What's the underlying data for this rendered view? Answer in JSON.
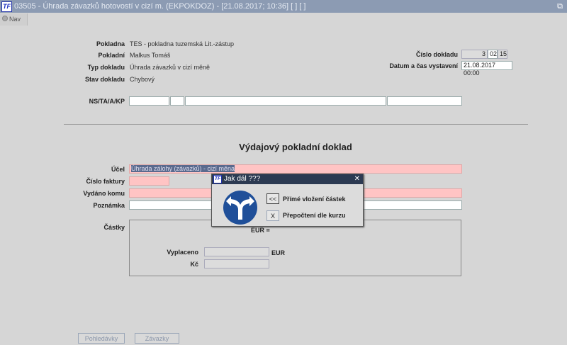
{
  "window": {
    "title": "03505 - Úhrada závazků hotovostí v cizí m. (EKPOKDOZ) - [21.08.2017; 10:36]  [ ]  [ ]",
    "logo": "TF"
  },
  "nav": {
    "label": "Nav"
  },
  "header": {
    "pokladna": {
      "label": "Pokladna",
      "value": "TES - pokladna tuzemská Lit.-zástup"
    },
    "pokladni": {
      "label": "Pokladní",
      "value": "Malkus Tomáš"
    },
    "typ": {
      "label": "Typ dokladu",
      "value": "Úhrada závazků v cizí měně"
    },
    "stav": {
      "label": "Stav dokladu",
      "value": "Chybový"
    },
    "ns": {
      "label": "NS/TA/A/KP"
    },
    "cislo": {
      "label": "Číslo dokladu",
      "parts": [
        "3",
        "02",
        "15"
      ]
    },
    "datum": {
      "label": "Datum a čas vystavení",
      "value": "21.08.2017 00:00"
    }
  },
  "form": {
    "heading": "Výdajový pokladní doklad",
    "ucel": {
      "label": "Účel",
      "value": "Úhrada zálohy (závazků) - cizí měna"
    },
    "faktura": {
      "label": "Číslo faktury"
    },
    "vydano": {
      "label": "Vydáno komu"
    },
    "poznamka": {
      "label": "Poznámka"
    },
    "castky": {
      "label": "Částky",
      "eur_eq": "EUR  =",
      "vyplaceno": "Vyplaceno",
      "eur": "EUR",
      "kc": "Kč"
    }
  },
  "buttons": {
    "pohledavky": "Pohledávky",
    "zavazky": "Závazky"
  },
  "dialog": {
    "title": "Jak dál ???",
    "opt1_btn": "<<",
    "opt1": "Přímé vložení částek",
    "opt2_btn": "X",
    "opt2": "Přepočtení dle kurzu"
  }
}
